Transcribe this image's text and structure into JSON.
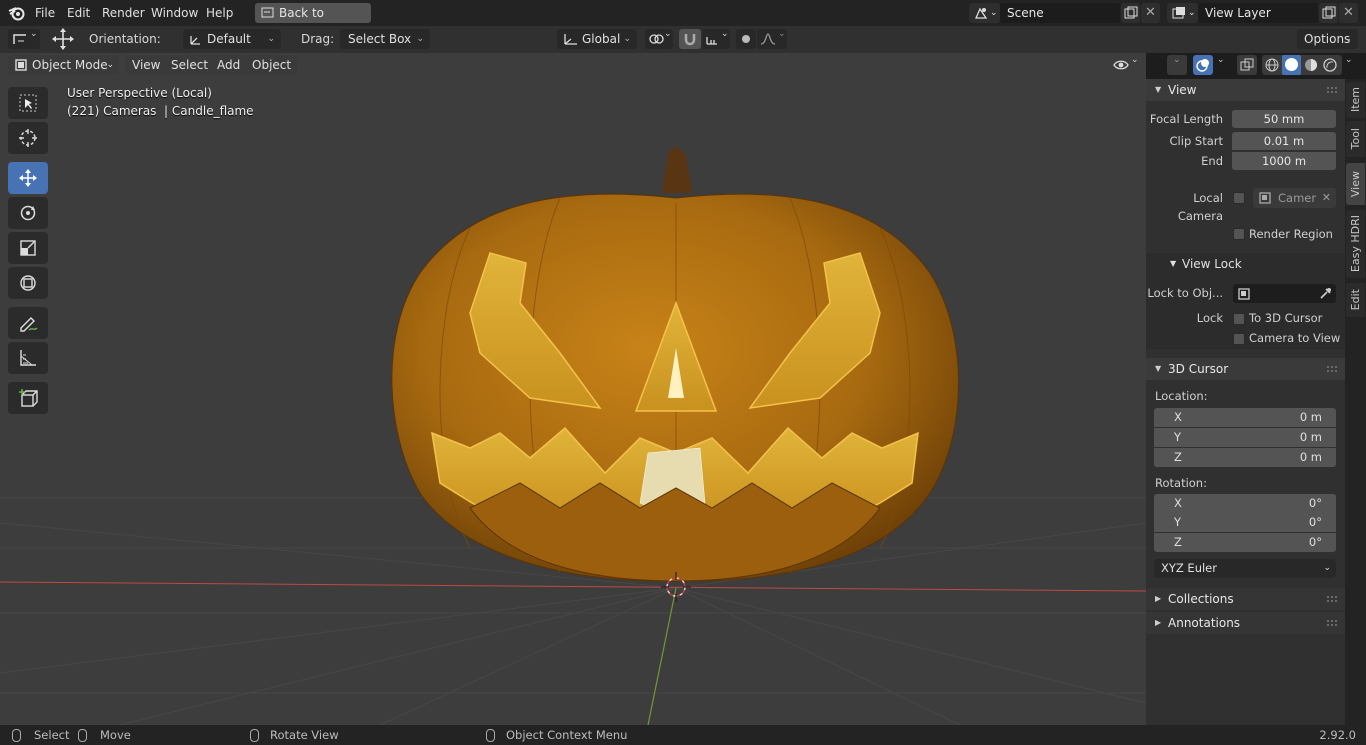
{
  "topbar": {
    "menus": [
      "File",
      "Edit",
      "Render",
      "Window",
      "Help"
    ],
    "back_button": "Back to Previous",
    "scene_name": "Scene",
    "view_layer": "View Layer"
  },
  "toolheader": {
    "orientation_label": "Orientation:",
    "orientation_value": "Default",
    "drag_label": "Drag:",
    "drag_value": "Select Box",
    "transform_space": "Global",
    "options_label": "Options"
  },
  "viewport_header": {
    "mode": "Object Mode",
    "menus": [
      "View",
      "Select",
      "Add",
      "Object"
    ]
  },
  "overlay_text": {
    "perspective": "User Perspective (Local)",
    "object_info": "(221) Cameras  | Candle_flame"
  },
  "npanel": {
    "view": {
      "title": "View",
      "focal_length_label": "Focal Length",
      "focal_length": "50 mm",
      "clip_start_label": "Clip Start",
      "clip_start": "0.01 m",
      "end_label": "End",
      "end": "1000 m",
      "local_camera_label": "Local Camera",
      "local_camera_value": "Camer",
      "render_region_label": "Render Region"
    },
    "view_lock": {
      "title": "View Lock",
      "lock_to_obj_label": "Lock to Obj...",
      "lock_label": "Lock",
      "to_3d_cursor_label": "To 3D Cursor",
      "camera_to_view_label": "Camera to View"
    },
    "cursor": {
      "title": "3D Cursor",
      "location_label": "Location:",
      "loc_x_label": "X",
      "loc_x": "0 m",
      "loc_y_label": "Y",
      "loc_y": "0 m",
      "loc_z_label": "Z",
      "loc_z": "0 m",
      "rotation_label": "Rotation:",
      "rot_x_label": "X",
      "rot_x": "0°",
      "rot_y_label": "Y",
      "rot_y": "0°",
      "rot_z_label": "Z",
      "rot_z": "0°",
      "rotation_mode": "XYZ Euler"
    },
    "collections_title": "Collections",
    "annotations_title": "Annotations"
  },
  "side_tabs": [
    "Item",
    "Tool",
    "View",
    "Easy HDRI",
    "Edit"
  ],
  "statusbar": {
    "select": "Select",
    "move": "Move",
    "rotate_view": "Rotate View",
    "context_menu": "Object Context Menu",
    "version": "2.92.0"
  },
  "colors": {
    "accent": "#4772b3",
    "viewport_bg": "#3d3d3d",
    "pumpkin": "#b06e12",
    "x_axis": "#c04848",
    "y_axis": "#6e9a35"
  }
}
